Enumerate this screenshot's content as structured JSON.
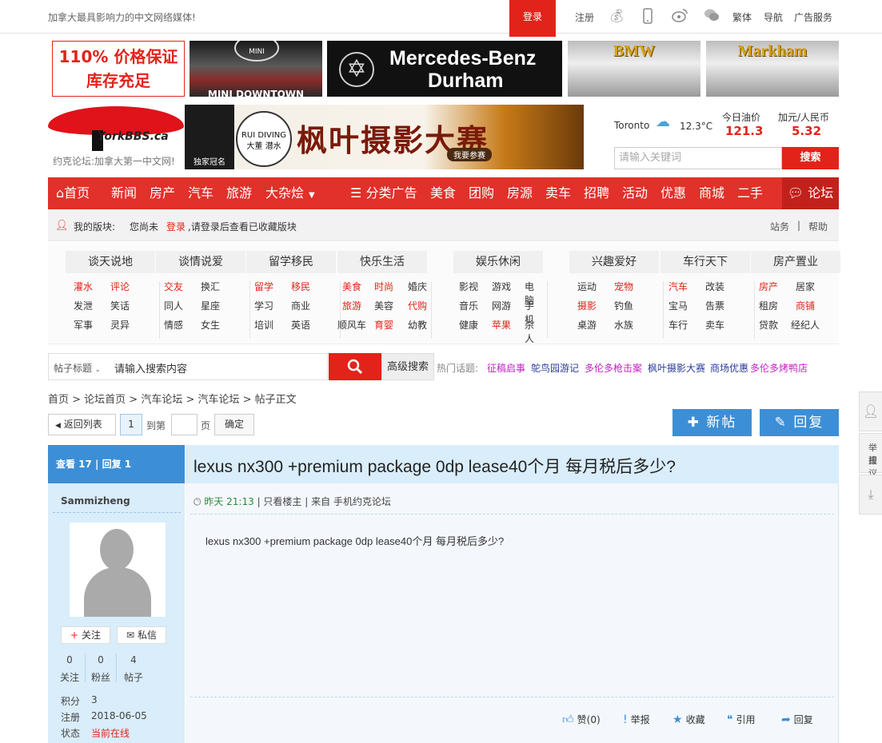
{
  "topbar": {
    "slogan": "加拿大最具影响力的中文网络媒体!",
    "login": "登录",
    "register": "注册",
    "links": [
      "繁体",
      "导航",
      "广告服务"
    ]
  },
  "ads": {
    "ad1_line1": "110% 价格保证",
    "ad1_line2": "库存充足",
    "ad2": "MINI DOWNTOWN",
    "ad2_logo": "MINI",
    "ad3_line1": "Mercedes-Benz",
    "ad3_line2": "Durham",
    "ad4": "BMW",
    "ad5": "Markham"
  },
  "logo": {
    "text": "YorkBBS.ca",
    "subtitle": "约克论坛:加拿大第一中文网!"
  },
  "banner": {
    "crown": "独家冠名",
    "sponsor_top": "RUI DIVING",
    "sponsor": "大董 潜水",
    "title": "枫叶摄影大赛",
    "button": "我要参赛"
  },
  "weather": {
    "city": "Toronto",
    "temp": "12.3°C",
    "oil_label": "今日油价",
    "oil_value": "121.3",
    "fx_label": "加元/人民币",
    "fx_value": "5.32"
  },
  "top_search": {
    "placeholder": "请输入关键词",
    "button": "搜索"
  },
  "nav": {
    "items": [
      "首页",
      "新闻",
      "房产",
      "汽车",
      "旅游",
      "大杂烩",
      "分类广告",
      "美食",
      "团购",
      "房源",
      "卖车",
      "招聘",
      "活动",
      "优惠",
      "商城",
      "二手"
    ],
    "forum": "论坛"
  },
  "myboard": {
    "label": "我的版块:",
    "prefix": "您尚未",
    "login": "登录",
    "suffix": ",请登录后查看已收藏版块",
    "right1": "站务",
    "right2": "帮助"
  },
  "categories": [
    {
      "title": "谈天说地",
      "links": [
        "灌水",
        "评论",
        "发泄",
        "笑话",
        "军事",
        "灵异"
      ]
    },
    {
      "title": "谈情说爱",
      "links": [
        "交友",
        "换汇",
        "同人",
        "星座",
        "情感",
        "女生"
      ]
    },
    {
      "title": "留学移民",
      "links": [
        "留学",
        "移民",
        "学习",
        "商业",
        "培训",
        "英语"
      ]
    },
    {
      "title": "快乐生活",
      "links": [
        "美食",
        "时尚",
        "婚庆",
        "旅游",
        "美容",
        "代购",
        "顺风车",
        "育婴",
        "幼教"
      ]
    },
    {
      "title": "娱乐休闲",
      "links": [
        "影视",
        "游戏",
        "电脑",
        "音乐",
        "网游",
        "手机",
        "健康",
        "苹果",
        "杀人"
      ]
    },
    {
      "title": "兴趣爱好",
      "links": [
        "运动",
        "宠物",
        "摄影",
        "钓鱼",
        "桌游",
        "水族"
      ]
    },
    {
      "title": "车行天下",
      "links": [
        "汽车",
        "改装",
        "宝马",
        "告票",
        "车行",
        "卖车"
      ]
    },
    {
      "title": "房产置业",
      "links": [
        "房产",
        "居家",
        "租房",
        "商铺",
        "贷款",
        "经纪人"
      ]
    }
  ],
  "search": {
    "type": "帖子标题",
    "input": "请输入搜索内容",
    "advanced": "高级搜索",
    "hot_label": "热门话题:",
    "hot_topics": [
      "征稿启事",
      "鸵鸟园游记",
      "多伦多枪击案",
      "枫叶摄影大赛",
      "商场优惠",
      "多伦多烤鸭店"
    ]
  },
  "breadcrumb": "首页 > 论坛首页 > 汽车论坛 > 汽车论坛 > 帖子正文",
  "pager": {
    "back": "返回列表",
    "page": "1",
    "goto_prefix": "到第",
    "goto_suffix": "页",
    "confirm": "确定",
    "new_post": "新帖",
    "reply": "回复"
  },
  "post": {
    "stats": "查看 17 | 回复 1",
    "username": "Sammizheng",
    "follow": "关注",
    "message": "私信",
    "counts": [
      {
        "value": "0",
        "label": "关注"
      },
      {
        "value": "0",
        "label": "粉丝"
      },
      {
        "value": "4",
        "label": "帖子"
      }
    ],
    "points_label": "积分",
    "points": "3",
    "reg_label": "注册",
    "reg_date": "2018-06-05",
    "status_label": "状态",
    "status": "当前在线",
    "title": "lexus nx300 +premium package 0dp lease40个月 每月税后多少?",
    "time": "昨天 21:13",
    "only_author": "只看楼主",
    "source": "来自 手机约克论坛",
    "content": "lexus nx300 +premium package 0dp lease40个月 每月税后多少?",
    "actions": [
      "赞(0)",
      "举报",
      "收藏",
      "引用",
      "回复"
    ]
  },
  "float": {
    "report": "举报",
    "suggest": "建议"
  }
}
